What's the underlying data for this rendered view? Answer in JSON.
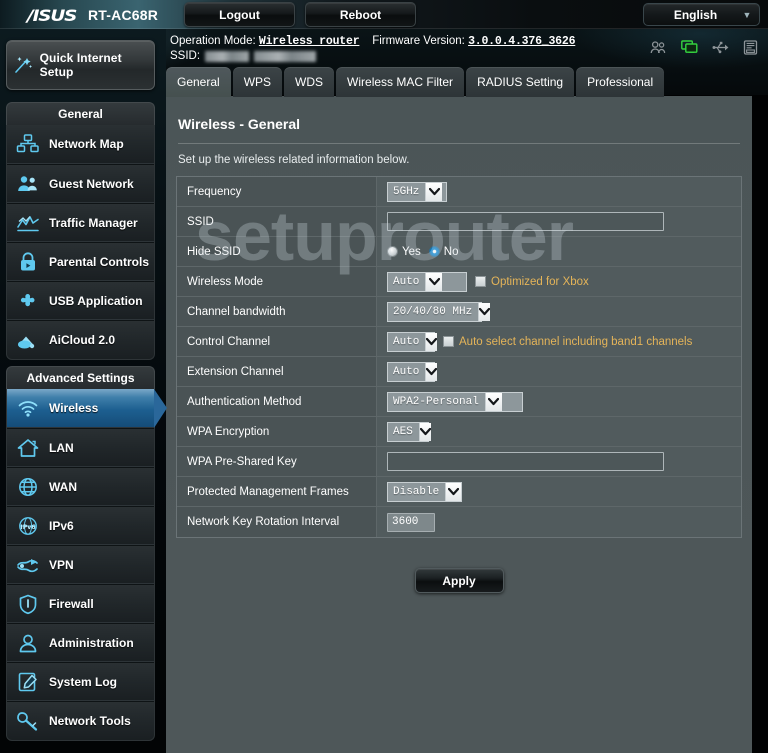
{
  "topbar": {
    "brand": "/ISUS",
    "model": "RT-AC68R",
    "logout_label": "Logout",
    "reboot_label": "Reboot",
    "language": "English",
    "caret": "▼"
  },
  "header": {
    "operation_mode_label": "Operation Mode:",
    "operation_mode_value": "Wireless router",
    "firmware_label": "Firmware Version:",
    "firmware_value": "3.0.0.4.376_3626",
    "ssid_label": "SSID:",
    "ssid_value": "",
    "status_icons": [
      {
        "name": "guest-users-icon",
        "color": "#8d9498"
      },
      {
        "name": "network-clients-icon",
        "color": "#35d23f"
      },
      {
        "name": "usb-icon",
        "color": "#8d9498"
      },
      {
        "name": "printer-icon",
        "color": "#8d9498"
      }
    ]
  },
  "sidebar": {
    "quick_setup_label": "Quick Internet Setup",
    "groups": [
      {
        "title": "General",
        "items": [
          {
            "label": "Network Map",
            "icon": "network-map-icon",
            "active": false
          },
          {
            "label": "Guest Network",
            "icon": "guest-network-icon",
            "active": false
          },
          {
            "label": "Traffic Manager",
            "icon": "traffic-manager-icon",
            "active": false
          },
          {
            "label": "Parental Controls",
            "icon": "parental-controls-icon",
            "active": false
          },
          {
            "label": "USB Application",
            "icon": "usb-application-icon",
            "active": false
          },
          {
            "label": "AiCloud 2.0",
            "icon": "aicloud-icon",
            "active": false
          }
        ]
      },
      {
        "title": "Advanced Settings",
        "items": [
          {
            "label": "Wireless",
            "icon": "wireless-icon",
            "active": true
          },
          {
            "label": "LAN",
            "icon": "lan-icon",
            "active": false
          },
          {
            "label": "WAN",
            "icon": "wan-icon",
            "active": false
          },
          {
            "label": "IPv6",
            "icon": "ipv6-icon",
            "active": false
          },
          {
            "label": "VPN",
            "icon": "vpn-icon",
            "active": false
          },
          {
            "label": "Firewall",
            "icon": "firewall-icon",
            "active": false
          },
          {
            "label": "Administration",
            "icon": "administration-icon",
            "active": false
          },
          {
            "label": "System Log",
            "icon": "system-log-icon",
            "active": false
          },
          {
            "label": "Network Tools",
            "icon": "network-tools-icon",
            "active": false
          }
        ]
      }
    ]
  },
  "tabs": [
    {
      "label": "General",
      "active": true
    },
    {
      "label": "WPS",
      "active": false
    },
    {
      "label": "WDS",
      "active": false
    },
    {
      "label": "Wireless MAC Filter",
      "active": false
    },
    {
      "label": "RADIUS Setting",
      "active": false
    },
    {
      "label": "Professional",
      "active": false
    }
  ],
  "panel": {
    "title": "Wireless - General",
    "description": "Set up the wireless related information below.",
    "apply_label": "Apply"
  },
  "form": {
    "frequency": {
      "label": "Frequency",
      "value": "5GHz"
    },
    "ssid": {
      "label": "SSID",
      "value": "",
      "placeholder": ""
    },
    "hide_ssid": {
      "label": "Hide SSID",
      "yes_label": "Yes",
      "no_label": "No",
      "selected": "No"
    },
    "wireless_mode": {
      "label": "Wireless Mode",
      "value": "Auto",
      "xbox_label": "Optimized for Xbox",
      "xbox_checked": false
    },
    "channel_bandwidth": {
      "label": "Channel bandwidth",
      "value": "20/40/80 MHz"
    },
    "control_channel": {
      "label": "Control Channel",
      "value": "Auto",
      "note_label": "Auto select channel including band1 channels",
      "note_checked": false
    },
    "extension_channel": {
      "label": "Extension Channel",
      "value": "Auto"
    },
    "authentication_method": {
      "label": "Authentication Method",
      "value": "WPA2-Personal"
    },
    "wpa_encryption": {
      "label": "WPA Encryption",
      "value": "AES"
    },
    "wpa_psk": {
      "label": "WPA Pre-Shared Key",
      "value": "",
      "placeholder": ""
    },
    "pmf": {
      "label": "Protected Management Frames",
      "value": "Disable"
    },
    "key_rotation": {
      "label": "Network Key Rotation Interval",
      "value": "3600"
    }
  },
  "watermark": {
    "text": "setuprouter"
  },
  "colors": {
    "accent_blue": "#1d5f90",
    "note_orange": "#e4b459",
    "panel_bg": "#4e5759",
    "active_green": "#35d23f"
  }
}
